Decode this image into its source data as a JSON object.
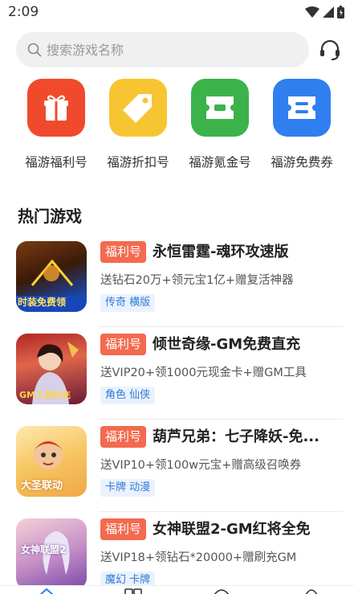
{
  "status_bar": {
    "time": "2:09"
  },
  "search": {
    "placeholder": "搜索游戏名称"
  },
  "quick_links": [
    {
      "label": "福游福利号",
      "icon": "gift-icon",
      "color": "#f04a2c"
    },
    {
      "label": "福游折扣号",
      "icon": "tag-icon",
      "color": "#f7c531"
    },
    {
      "label": "福游氪金号",
      "icon": "ticket-icon",
      "color": "#3bb24a"
    },
    {
      "label": "福游免费券",
      "icon": "coupon-icon",
      "color": "#2f7ff0"
    }
  ],
  "section": {
    "title": "热门游戏"
  },
  "games": [
    {
      "badge": "福利号",
      "name": "永恒雷霆-魂环攻速版",
      "desc": "送钻石20万+领元宝1亿+赠复活神器",
      "tags": "传奇 横版",
      "thumb_text": "时装免费领"
    },
    {
      "badge": "福利号",
      "name": "倾世奇缘-GM免费直充",
      "desc": "送VIP20+领1000元现金卡+赠GM工具",
      "tags": "角色 仙侠",
      "thumb_text": "GM工具利充"
    },
    {
      "badge": "福利号",
      "name": "葫芦兄弟：七子降妖-免...",
      "desc": "送VIP10+领100w元宝+赠高级召唤券",
      "tags": "卡牌 动漫",
      "thumb_text": "大圣联动"
    },
    {
      "badge": "福利号",
      "name": "女神联盟2-GM红将全免",
      "desc": "送VIP18+领钻石*20000+赠刷充GM",
      "tags": "魔幻 卡牌",
      "thumb_text": "女神联盟2"
    }
  ]
}
